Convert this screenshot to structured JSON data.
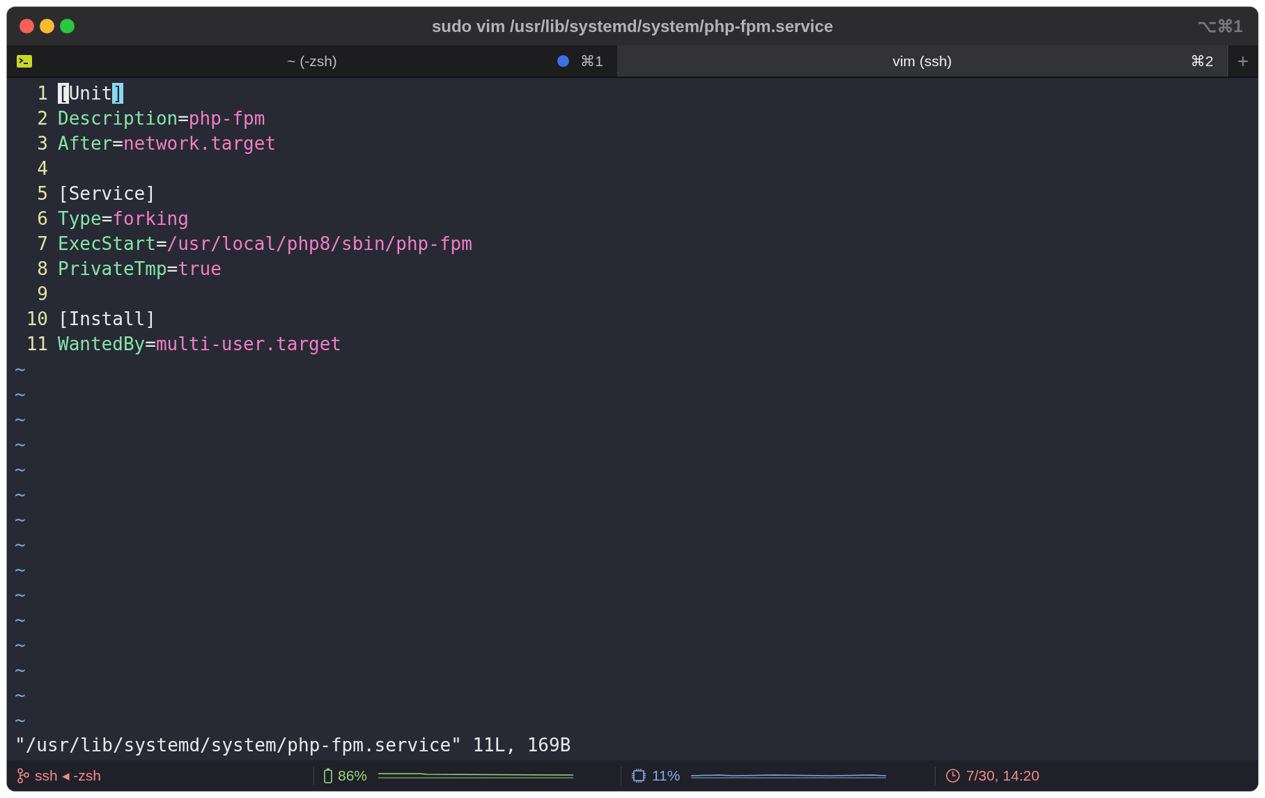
{
  "window": {
    "title": "sudo vim /usr/lib/systemd/system/php-fpm.service",
    "shortcut": "⌥⌘1"
  },
  "tabs": [
    {
      "label": "~ (-zsh)",
      "shortcut": "⌘1",
      "selected": false,
      "activity": true
    },
    {
      "label": "vim (ssh)",
      "shortcut": "⌘2",
      "selected": true,
      "activity": false
    }
  ],
  "new_tab": "+",
  "editor": {
    "lines": [
      {
        "number": "1",
        "tokens": [
          {
            "text": "[",
            "kind": "cursor"
          },
          {
            "text": "Unit",
            "kind": "section"
          },
          {
            "text": "]",
            "kind": "match"
          }
        ]
      },
      {
        "number": "2",
        "tokens": [
          {
            "text": "Description",
            "kind": "key"
          },
          {
            "text": "=",
            "kind": "section"
          },
          {
            "text": "php-fpm",
            "kind": "value"
          }
        ]
      },
      {
        "number": "3",
        "tokens": [
          {
            "text": "After",
            "kind": "key"
          },
          {
            "text": "=",
            "kind": "section"
          },
          {
            "text": "network.target",
            "kind": "value"
          }
        ]
      },
      {
        "number": "4"
      },
      {
        "number": "5",
        "tokens": [
          {
            "text": "[Service]",
            "kind": "section"
          }
        ]
      },
      {
        "number": "6",
        "tokens": [
          {
            "text": "Type",
            "kind": "key"
          },
          {
            "text": "=",
            "kind": "section"
          },
          {
            "text": "forking",
            "kind": "value"
          }
        ]
      },
      {
        "number": "7",
        "tokens": [
          {
            "text": "ExecStart",
            "kind": "key"
          },
          {
            "text": "=",
            "kind": "section"
          },
          {
            "text": "/usr/local/php8/sbin/php-fpm",
            "kind": "value"
          }
        ]
      },
      {
        "number": "8",
        "tokens": [
          {
            "text": "PrivateTmp",
            "kind": "key"
          },
          {
            "text": "=",
            "kind": "section"
          },
          {
            "text": "true",
            "kind": "value"
          }
        ]
      },
      {
        "number": "9"
      },
      {
        "number": "10",
        "tokens": [
          {
            "text": "[Install]",
            "kind": "section"
          }
        ]
      },
      {
        "number": "11",
        "tokens": [
          {
            "text": "WantedBy",
            "kind": "key"
          },
          {
            "text": "=",
            "kind": "section"
          },
          {
            "text": "multi-user.target",
            "kind": "value"
          }
        ]
      }
    ],
    "empty_lines": [
      "~",
      "~",
      "~",
      "~",
      "~",
      "~",
      "~",
      "~",
      "~",
      "~",
      "~",
      "~",
      "~",
      "~",
      "~"
    ],
    "message": "\"/usr/lib/systemd/system/php-fpm.service\" 11L, 169B"
  },
  "status_bar": [
    {
      "kind": "session",
      "text": "ssh ◂ -zsh"
    },
    {
      "kind": "battery",
      "text": "86%"
    },
    {
      "kind": "cpu",
      "text": "11%"
    },
    {
      "kind": "clock",
      "text": "7/30, 14:20"
    }
  ]
}
